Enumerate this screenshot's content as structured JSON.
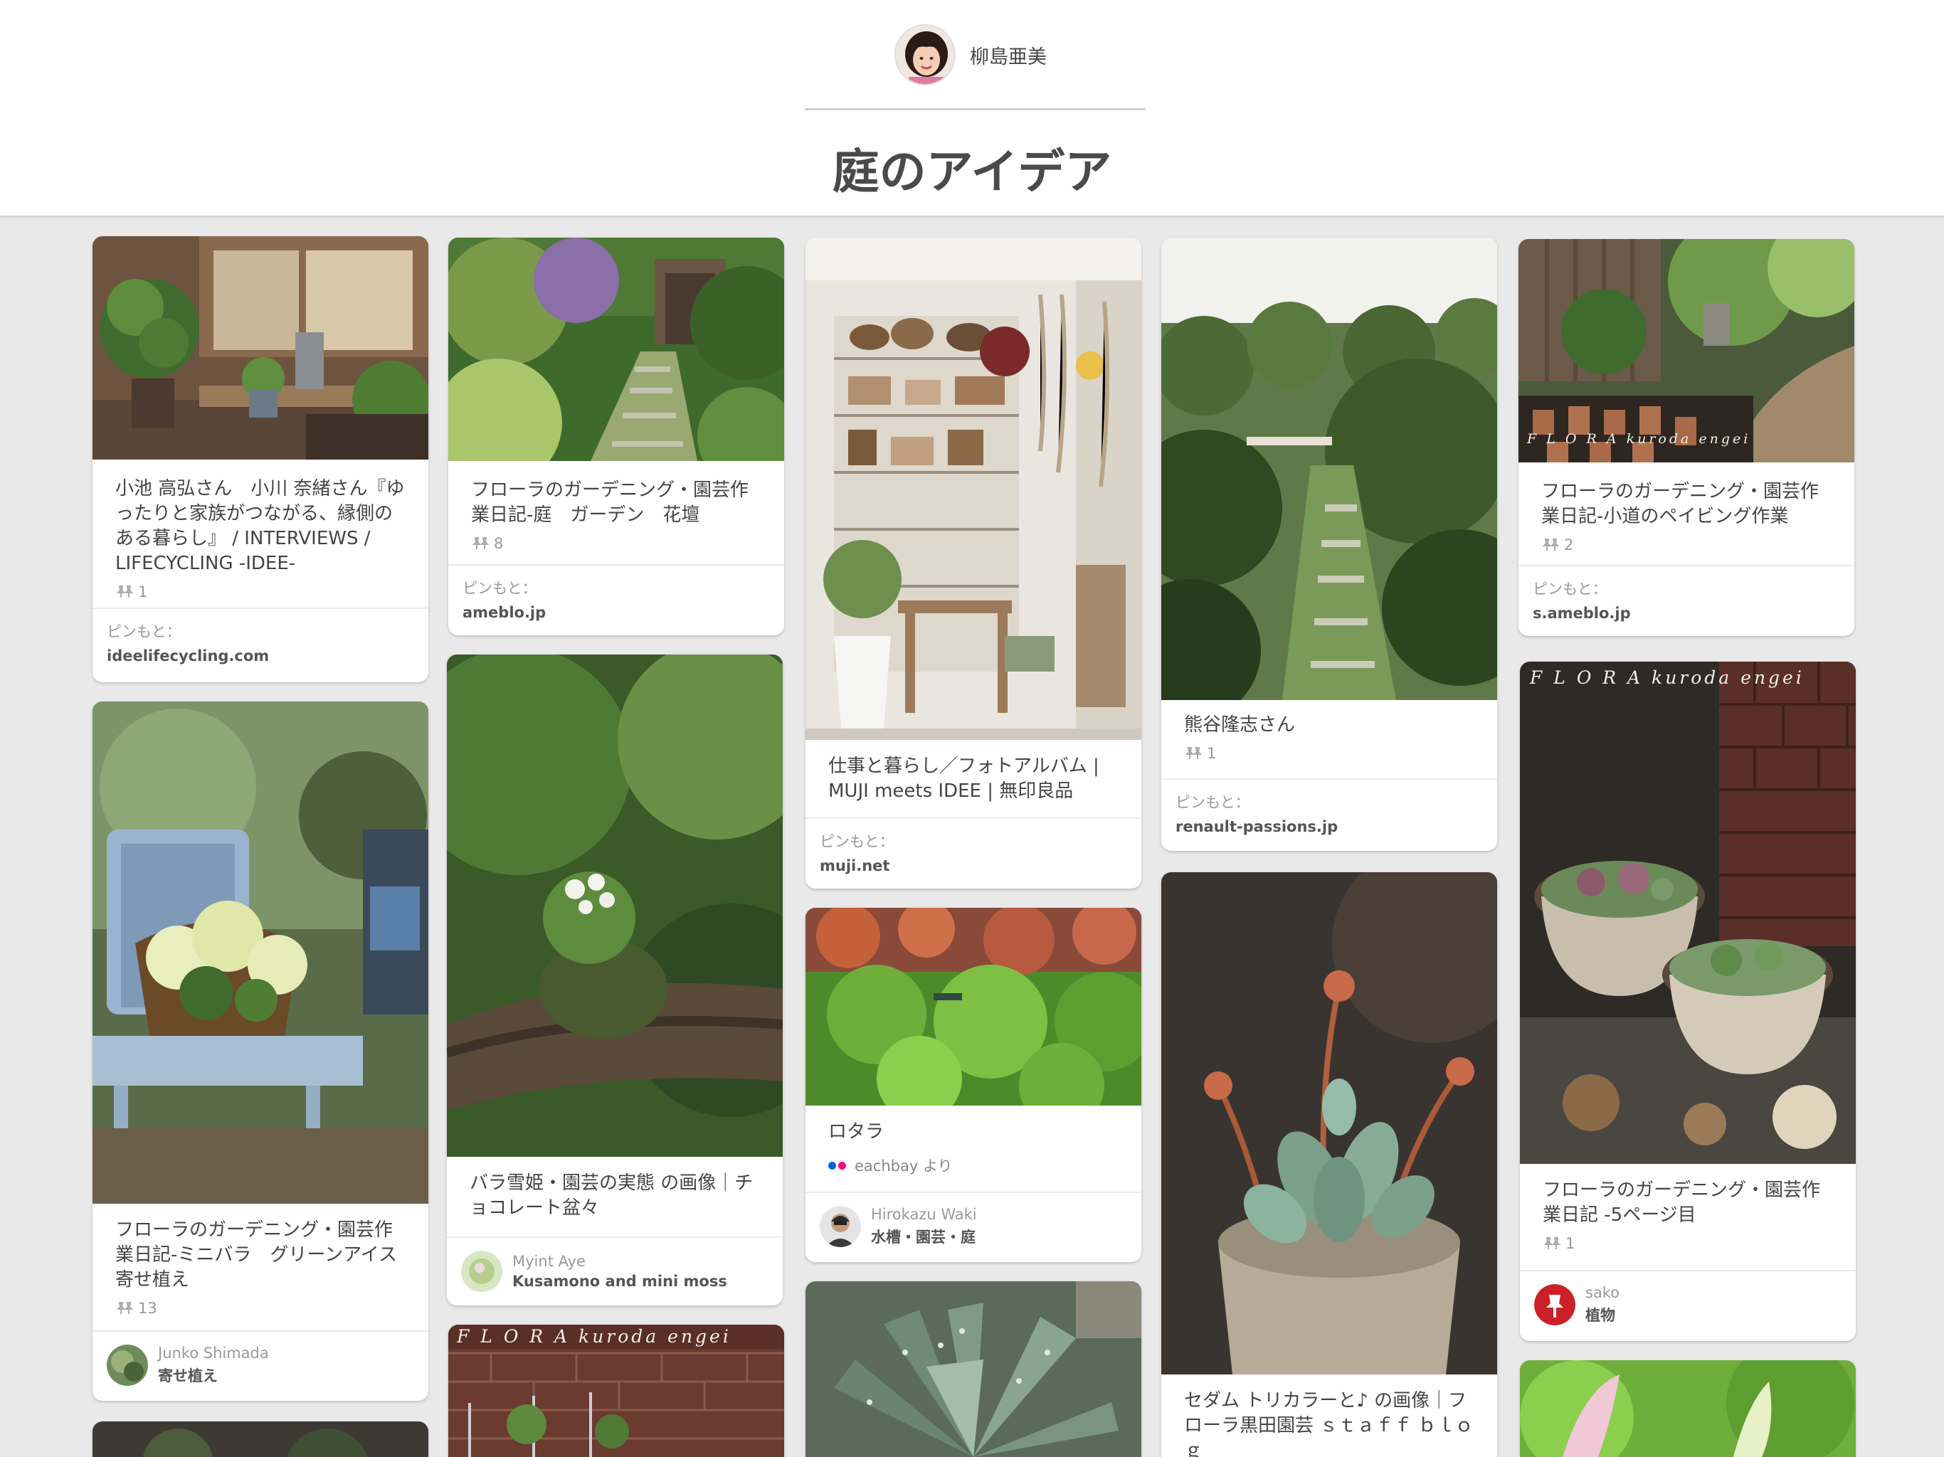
{
  "header": {
    "owner_name": "柳島亜美",
    "board_title": "庭のアイデア"
  },
  "pins": [
    {
      "description": "小池 高弘さん　小川 奈緒さん『ゆったりと家族がつながる、縁側のある暮らし』 / INTERVIEWS / LIFECYCLING -IDEE-",
      "repins": "1",
      "source_label": "ピンもと：",
      "source_domain": "ideelifecycling.com"
    },
    {
      "description": "フローラのガーデニング・園芸作業日記-ミニバラ　グリーンアイス　寄せ植え",
      "repins": "13",
      "pinner_name": "Junko Shimada",
      "pinner_board": "寄せ植え"
    },
    {
      "description": "フローラのガーデニング・園芸作業日記-庭　ガーデン　花壇",
      "repins": "8",
      "source_label": "ピンもと：",
      "source_domain": "ameblo.jp"
    },
    {
      "description": "バラ雪姫・園芸の実態 の画像｜チョコレート盆々",
      "pinner_name": "Myint Aye",
      "pinner_board": "Kusamono and mini moss"
    },
    {
      "description": "仕事と暮らし／フォトアルバム | MUJI meets IDEE | 無印良品",
      "source_label": "ピンもと：",
      "source_domain": "muji.net"
    },
    {
      "description": "ロタラ",
      "via": "eachbay より",
      "pinner_name": "Hirokazu Waki",
      "pinner_board": "水槽・園芸・庭"
    },
    {
      "description": "熊谷隆志さん",
      "repins": "1",
      "source_label": "ピンもと：",
      "source_domain": "renault-passions.jp"
    },
    {
      "description": "セダム トリカラーと♪ の画像｜フローラ黒田園芸 ｓｔａｆｆ ｂｌｏｇ"
    },
    {
      "description": "フローラのガーデニング・園芸作業日記-小道のペイビング作業",
      "repins": "2",
      "source_label": "ピンもと：",
      "source_domain": "s.ameblo.jp"
    },
    {
      "description": "フローラのガーデニング・園芸作業日記 -5ページ目",
      "repins": "1",
      "pinner_name": "sako",
      "pinner_board": "植物"
    }
  ],
  "watermarks": {
    "flora_1": "F L O R A  kuroda engei",
    "flora_2": "F L O R A  kuroda engei",
    "flora_3": "F L O R A  kuroda engei"
  },
  "colors": {
    "background": "#e9e9e9",
    "card": "#ffffff",
    "pinterest_red": "#cb2027",
    "muted_text": "#999999"
  }
}
